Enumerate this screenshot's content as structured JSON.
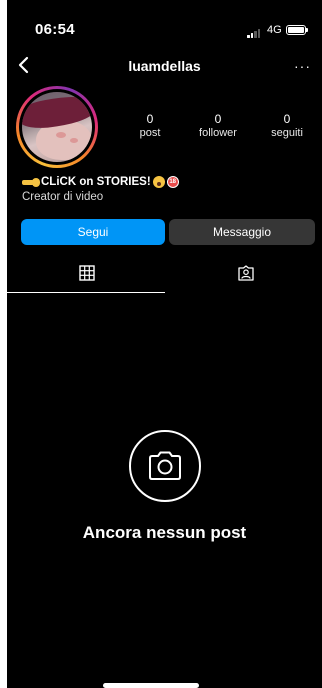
{
  "status_bar": {
    "time": "06:54",
    "network": "4G"
  },
  "header": {
    "username": "luamdellas",
    "more": "···"
  },
  "stats": [
    {
      "value": "0",
      "label": "post"
    },
    {
      "value": "0",
      "label": "follower"
    },
    {
      "value": "0",
      "label": "seguiti"
    }
  ],
  "bio": {
    "line1": "CLiCK on STORIES!",
    "line2": "Creator di video"
  },
  "buttons": {
    "follow": "Segui",
    "message": "Messaggio"
  },
  "tabs": [
    {
      "icon": "grid-icon",
      "active": true
    },
    {
      "icon": "tagged-person-icon",
      "active": false
    }
  ],
  "empty_state": {
    "icon": "camera-icon",
    "text": "Ancora nessun post"
  },
  "colors": {
    "follow": "#0095f6",
    "message": "#363636",
    "background": "#000000"
  }
}
